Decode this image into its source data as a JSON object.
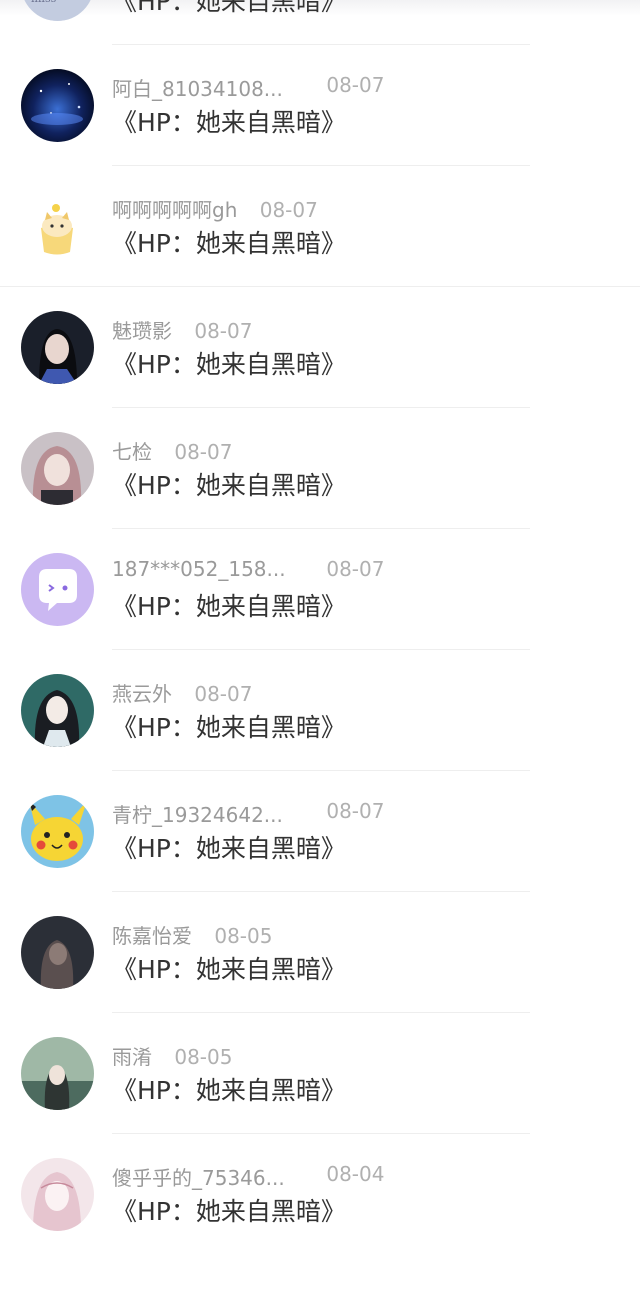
{
  "items": [
    {
      "name": "",
      "date": "",
      "title": "《HP：她来自黑暗》",
      "avatar": "winter-art-avatar"
    },
    {
      "name": "阿白_81034108...",
      "date": "08-07",
      "title": "《HP：她来自黑暗》",
      "avatar": "starry-sky-avatar"
    },
    {
      "name": "啊啊啊啊啊gh",
      "date": "08-07",
      "title": "《HP：她来自黑暗》",
      "avatar": "cat-cup-avatar"
    },
    {
      "name": "魅瓒影",
      "date": "08-07",
      "title": "《HP：她来自黑暗》",
      "avatar": "woman-portrait-avatar"
    },
    {
      "name": "七检",
      "date": "08-07",
      "title": "《HP：她来自黑暗》",
      "avatar": "anime-girl-avatar"
    },
    {
      "name": "187***052_158...",
      "date": "08-07",
      "title": "《HP：她来自黑暗》",
      "avatar": "chat-bubble-avatar"
    },
    {
      "name": "燕云外",
      "date": "08-07",
      "title": "《HP：她来自黑暗》",
      "avatar": "ancient-girl-avatar"
    },
    {
      "name": "青柠_19324642...",
      "date": "08-07",
      "title": "《HP：她来自黑暗》",
      "avatar": "pikachu-avatar"
    },
    {
      "name": "陈嘉怡爱",
      "date": "08-05",
      "title": "《HP：她来自黑暗》",
      "avatar": "dark-photo-avatar"
    },
    {
      "name": "雨淆",
      "date": "08-05",
      "title": "《HP：她来自黑暗》",
      "avatar": "rain-girl-avatar"
    },
    {
      "name": "傻乎乎的_75346...",
      "date": "08-04",
      "title": "《HP：她来自黑暗》",
      "avatar": "sketch-girl-avatar"
    }
  ]
}
